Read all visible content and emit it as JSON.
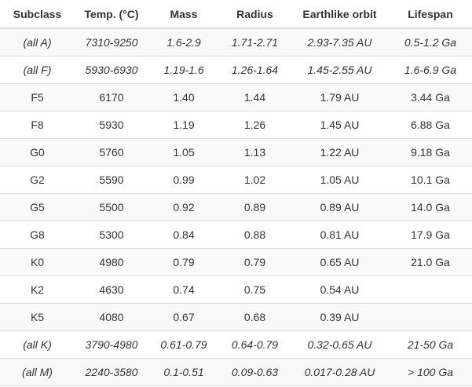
{
  "table": {
    "columns": [
      "Subclass",
      "Temp. (°C)",
      "Mass",
      "Radius",
      "Earthlike orbit",
      "Lifespan"
    ],
    "rows": [
      {
        "italic": true,
        "cells": [
          "(all A)",
          "7310-9250",
          "1.6-2.9",
          "1.71-2.71",
          "2.93-7.35 AU",
          "0.5-1.2 Ga"
        ]
      },
      {
        "italic": true,
        "cells": [
          "(all F)",
          "5930-6930",
          "1.19-1.6",
          "1.26-1.64",
          "1.45-2.55 AU",
          "1.6-6.9 Ga"
        ]
      },
      {
        "italic": false,
        "cells": [
          "F5",
          "6170",
          "1.40",
          "1.44",
          "1.79 AU",
          "3.44 Ga"
        ]
      },
      {
        "italic": false,
        "cells": [
          "F8",
          "5930",
          "1.19",
          "1.26",
          "1.45 AU",
          "6.88 Ga"
        ]
      },
      {
        "italic": false,
        "cells": [
          "G0",
          "5760",
          "1.05",
          "1.13",
          "1.22 AU",
          "9.18 Ga"
        ]
      },
      {
        "italic": false,
        "cells": [
          "G2",
          "5590",
          "0.99",
          "1.02",
          "1.05 AU",
          "10.1 Ga"
        ]
      },
      {
        "italic": false,
        "cells": [
          "G5",
          "5500",
          "0.92",
          "0.89",
          "0.89 AU",
          "14.0 Ga"
        ]
      },
      {
        "italic": false,
        "cells": [
          "G8",
          "5300",
          "0.84",
          "0.88",
          "0.81 AU",
          "17.9 Ga"
        ]
      },
      {
        "italic": false,
        "cells": [
          "K0",
          "4980",
          "0.79",
          "0.79",
          "0.65 AU",
          "21.0 Ga"
        ]
      },
      {
        "italic": false,
        "cells": [
          "K2",
          "4630",
          "0.74",
          "0.75",
          "0.54 AU",
          ""
        ]
      },
      {
        "italic": false,
        "cells": [
          "K5",
          "4080",
          "0.67",
          "0.68",
          "0.39 AU",
          ""
        ]
      },
      {
        "italic": true,
        "cells": [
          "(all K)",
          "3790-4980",
          "0.61-0.79",
          "0.64-0.79",
          "0.32-0.65 AU",
          "21-50 Ga"
        ]
      },
      {
        "italic": true,
        "cells": [
          "(all M)",
          "2240-3580",
          "0.1-0.51",
          "0.09-0.63",
          "0.017-0.28 AU",
          "> 100 Ga"
        ]
      }
    ]
  }
}
